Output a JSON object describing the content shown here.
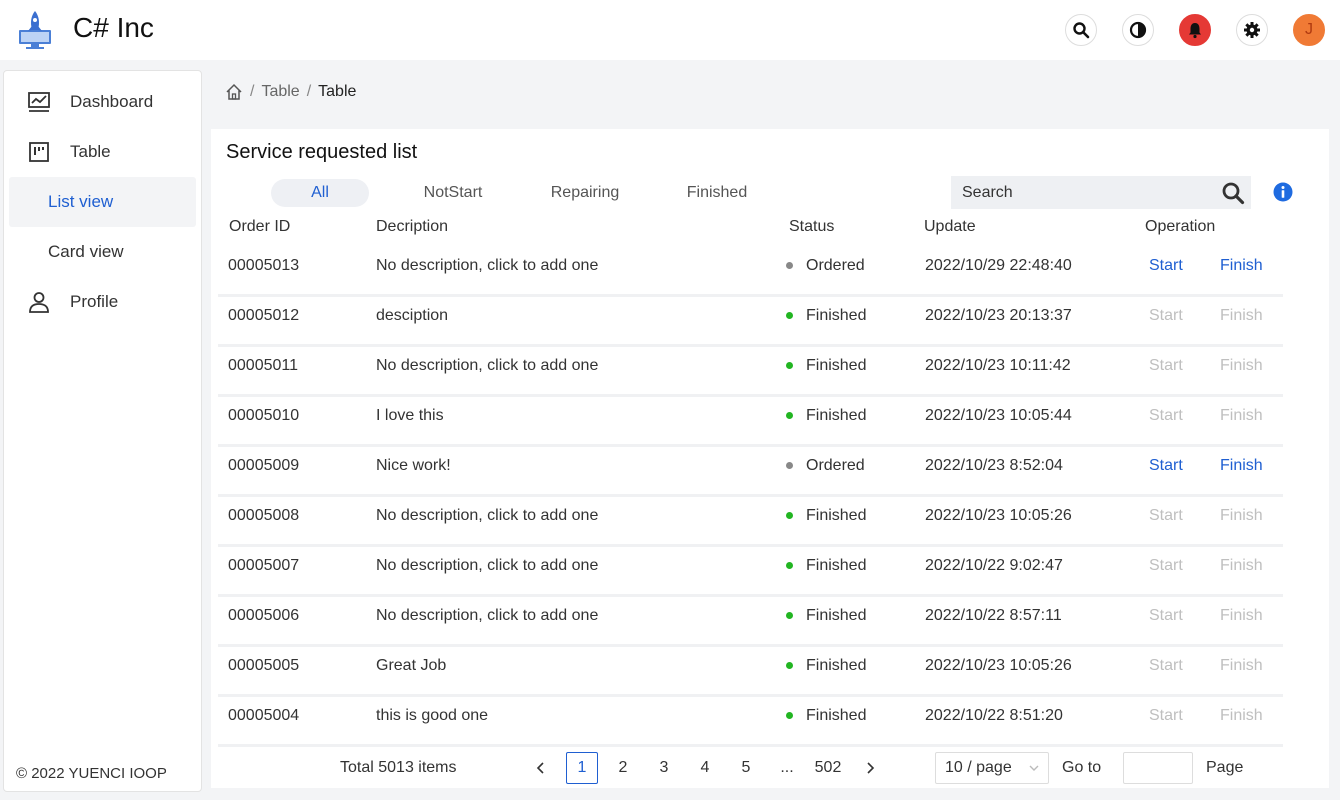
{
  "app": {
    "title": "C# Inc",
    "accent": "#1f5fd1"
  },
  "header": {
    "icons": [
      "search-icon",
      "contrast-icon",
      "bell-icon",
      "gear-icon",
      "avatar"
    ],
    "avatar_initial": "J"
  },
  "sidebar": {
    "items": [
      {
        "label": "Dashboard",
        "icon": "dashboard-icon"
      },
      {
        "label": "Table",
        "icon": "table-icon"
      },
      {
        "label": "List view",
        "active": true
      },
      {
        "label": "Card view"
      },
      {
        "label": "Profile",
        "icon": "user-icon"
      }
    ],
    "copyright": "© 2022 YUENCI IOOP"
  },
  "breadcrumb": {
    "items": [
      "Table",
      "Table"
    ]
  },
  "main": {
    "title": "Service requested list",
    "tabs": [
      "All",
      "NotStart",
      "Repairing",
      "Finished"
    ],
    "active_tab": "All",
    "search": {
      "placeholder": "Search"
    },
    "columns": [
      "Order ID",
      "Decription",
      "Status",
      "Update",
      "Operation"
    ],
    "rows": [
      {
        "id": "00005013",
        "desc": "No description, click to add one",
        "status": "Ordered",
        "update": "2022/10/29 22:48:40",
        "start": "Start",
        "finish": "Finish",
        "enabled": true
      },
      {
        "id": "00005012",
        "desc": "desciption",
        "status": "Finished",
        "update": "2022/10/23 20:13:37",
        "start": "Start",
        "finish": "Finish",
        "enabled": false
      },
      {
        "id": "00005011",
        "desc": "No description, click to add one",
        "status": "Finished",
        "update": "2022/10/23 10:11:42",
        "start": "Start",
        "finish": "Finish",
        "enabled": false
      },
      {
        "id": "00005010",
        "desc": "I love this",
        "status": "Finished",
        "update": "2022/10/23 10:05:44",
        "start": "Start",
        "finish": "Finish",
        "enabled": false
      },
      {
        "id": "00005009",
        "desc": "Nice work!",
        "status": "Ordered",
        "update": "2022/10/23 8:52:04",
        "start": "Start",
        "finish": "Finish",
        "enabled": true
      },
      {
        "id": "00005008",
        "desc": "No description, click to add one",
        "status": "Finished",
        "update": "2022/10/23 10:05:26",
        "start": "Start",
        "finish": "Finish",
        "enabled": false
      },
      {
        "id": "00005007",
        "desc": "No description, click to add one",
        "status": "Finished",
        "update": "2022/10/22 9:02:47",
        "start": "Start",
        "finish": "Finish",
        "enabled": false
      },
      {
        "id": "00005006",
        "desc": "No description, click to add one",
        "status": "Finished",
        "update": "2022/10/22 8:57:11",
        "start": "Start",
        "finish": "Finish",
        "enabled": false
      },
      {
        "id": "00005005",
        "desc": "Great Job",
        "status": "Finished",
        "update": "2022/10/23 10:05:26",
        "start": "Start",
        "finish": "Finish",
        "enabled": false
      },
      {
        "id": "00005004",
        "desc": "this is good one",
        "status": "Finished",
        "update": "2022/10/22 8:51:20",
        "start": "Start",
        "finish": "Finish",
        "enabled": false
      }
    ],
    "status_colors": {
      "Ordered": "#888888",
      "Finished": "#22b522"
    }
  },
  "pagination": {
    "total": "Total 5013 items",
    "pages": [
      "1",
      "2",
      "3",
      "4",
      "5",
      "...",
      "502"
    ],
    "current": "1",
    "page_size": "10 / page",
    "goto_label": "Go to",
    "page_label": "Page"
  }
}
